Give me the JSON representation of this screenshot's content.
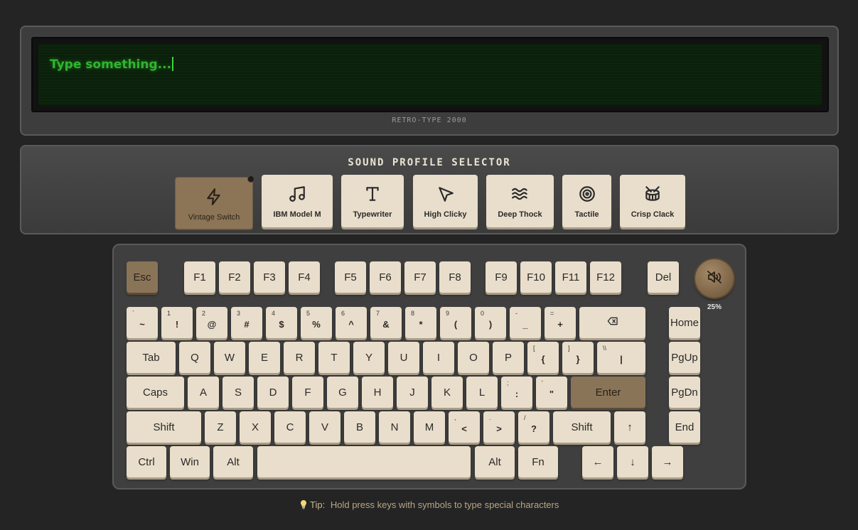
{
  "display": {
    "text": "Type something...",
    "brand": "RETRO-TYPE 2000"
  },
  "sound": {
    "title": "SOUND PROFILE SELECTOR",
    "profiles": [
      {
        "label": "Vintage Switch",
        "icon": "lightning-icon",
        "active": true
      },
      {
        "label": "IBM Model M",
        "icon": "music-note-icon",
        "active": false
      },
      {
        "label": "Typewriter",
        "icon": "type-icon",
        "active": false
      },
      {
        "label": "High Clicky",
        "icon": "cursor-arrow-icon",
        "active": false
      },
      {
        "label": "Deep Thock",
        "icon": "waves-icon",
        "active": false
      },
      {
        "label": "Tactile",
        "icon": "target-icon",
        "active": false
      },
      {
        "label": "Crisp Clack",
        "icon": "drum-icon",
        "active": false
      }
    ]
  },
  "keyboard": {
    "volume": "25%",
    "keys": {
      "esc": "Esc",
      "f1": "F1",
      "f2": "F2",
      "f3": "F3",
      "f4": "F4",
      "f5": "F5",
      "f6": "F6",
      "f7": "F7",
      "f8": "F8",
      "f9": "F9",
      "f10": "F10",
      "f11": "F11",
      "f12": "F12",
      "del": "Del",
      "backtick": {
        "sub": "`",
        "main": "~"
      },
      "n1": {
        "sub": "1",
        "main": "!"
      },
      "n2": {
        "sub": "2",
        "main": "@"
      },
      "n3": {
        "sub": "3",
        "main": "#"
      },
      "n4": {
        "sub": "4",
        "main": "$"
      },
      "n5": {
        "sub": "5",
        "main": "%"
      },
      "n6": {
        "sub": "6",
        "main": "^"
      },
      "n7": {
        "sub": "7",
        "main": "&"
      },
      "n8": {
        "sub": "8",
        "main": "*"
      },
      "n9": {
        "sub": "9",
        "main": "("
      },
      "n0": {
        "sub": "0",
        "main": ")"
      },
      "minus": {
        "sub": "-",
        "main": "_"
      },
      "equal": {
        "sub": "=",
        "main": "+"
      },
      "backspace": "⌫",
      "home": "Home",
      "tab": "Tab",
      "q": "Q",
      "w": "W",
      "e": "E",
      "r": "R",
      "t": "T",
      "y": "Y",
      "u": "U",
      "i": "I",
      "o": "O",
      "p": "P",
      "lbracket": {
        "sub": "[",
        "main": "{"
      },
      "rbracket": {
        "sub": "]",
        "main": "}"
      },
      "backslash": {
        "sub": "\\\\",
        "main": "|"
      },
      "pgup": "PgUp",
      "caps": "Caps",
      "a": "A",
      "s": "S",
      "d": "D",
      "f": "F",
      "g": "G",
      "h": "H",
      "j": "J",
      "k": "K",
      "l": "L",
      "semicolon": {
        "sub": ";",
        "main": ":"
      },
      "quote": {
        "sub": "'",
        "main": "\""
      },
      "enter": "Enter",
      "pgdn": "PgDn",
      "lshift": "Shift",
      "z": "Z",
      "x": "X",
      "c": "C",
      "v": "V",
      "b": "B",
      "n": "N",
      "m": "M",
      "comma": {
        "sub": ",",
        "main": "<"
      },
      "period": {
        "sub": ".",
        "main": ">"
      },
      "slash": {
        "sub": "/",
        "main": "?"
      },
      "rshift": "Shift",
      "up": "↑",
      "end": "End",
      "ctrl": "Ctrl",
      "win": "Win",
      "alt": "Alt",
      "space": "",
      "ralt": "Alt",
      "fn": "Fn",
      "left": "←",
      "down": "↓",
      "right": "→"
    }
  },
  "tip": {
    "label": "Tip:",
    "text": "Hold press keys with symbols to type special characters"
  },
  "colors": {
    "background": "#242424",
    "keycap": "#e9decb",
    "accent": "#8a7458",
    "screen_text": "#2fb52f"
  }
}
